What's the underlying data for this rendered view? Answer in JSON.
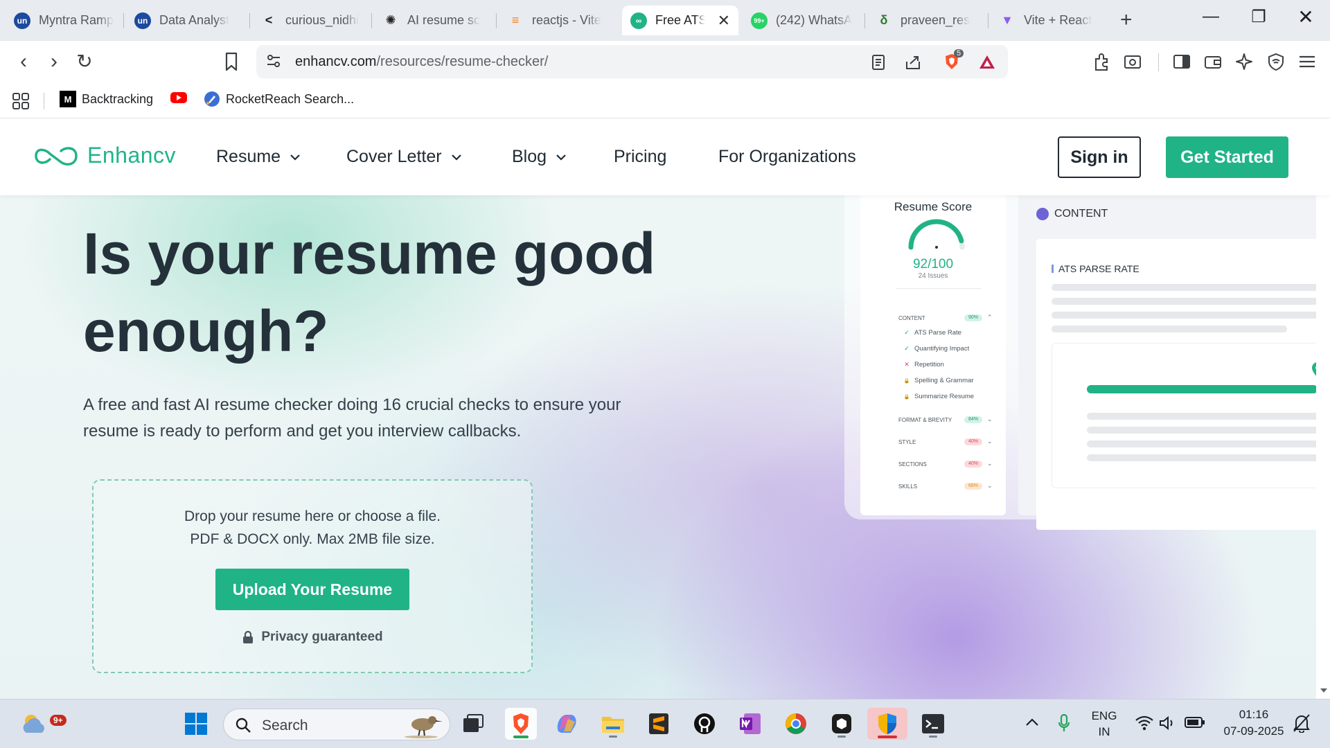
{
  "browser": {
    "tabs": [
      {
        "title": "Myntra Ramp",
        "icon": "unstop-icon",
        "color": "#1c4a9e"
      },
      {
        "title": "Data Analyst",
        "icon": "unstop-icon",
        "color": "#1c4a9e"
      },
      {
        "title": "curious_nidhi",
        "icon": "code-icon",
        "color": "#222"
      },
      {
        "title": "AI resume sc",
        "icon": "openai-icon",
        "color": "#222"
      },
      {
        "title": "reactjs - Vite",
        "icon": "stackoverflow-icon",
        "color": "#f48024"
      },
      {
        "title": "Free ATS",
        "icon": "enhancv-icon",
        "color": "#20b386",
        "active": true
      },
      {
        "title": "(242) WhatsA",
        "icon": "whatsapp-icon",
        "color": "#25d366",
        "badge": "99+"
      },
      {
        "title": "praveen_res",
        "icon": "leaf-icon",
        "color": "#2f7d32"
      },
      {
        "title": "Vite + React",
        "icon": "vite-icon",
        "color": "#8b5cf6"
      }
    ],
    "url_domain": "enhancv.com",
    "url_path": "/resources/resume-checker/",
    "brave_shield_count": "5",
    "bookmarks": [
      {
        "label": "Backtracking",
        "icon": "medium-icon"
      },
      {
        "label": "",
        "icon": "youtube-icon"
      },
      {
        "label": "RocketReach Search...",
        "icon": "rocketreach-icon"
      }
    ]
  },
  "site": {
    "logo_text": "Enhancv",
    "nav": [
      {
        "label": "Resume",
        "dropdown": true
      },
      {
        "label": "Cover Letter",
        "dropdown": true
      },
      {
        "label": "Blog",
        "dropdown": true
      },
      {
        "label": "Pricing",
        "dropdown": false
      },
      {
        "label": "For Organizations",
        "dropdown": false
      }
    ],
    "signin_label": "Sign in",
    "get_started_label": "Get Started",
    "brand_color": "#20b386"
  },
  "hero": {
    "title": "Is your resume good enough?",
    "subtitle": "A free and fast AI resume checker doing 16 crucial checks to ensure your resume is ready to perform and get you interview callbacks.",
    "drop_line1": "Drop your resume here or choose a file.",
    "drop_line2": "PDF & DOCX only. Max 2MB file size.",
    "upload_label": "Upload Your Resume",
    "privacy_label": "Privacy guaranteed"
  },
  "mock": {
    "score_title": "Resume Score",
    "score_value": "92/100",
    "score_fraction": 0.92,
    "issues": "24 Issues",
    "categories": [
      {
        "name": "CONTENT",
        "pct": "90%",
        "tone": "green",
        "expanded": true
      },
      {
        "name": "FORMAT & BREVITY",
        "pct": "84%",
        "tone": "green",
        "expanded": false
      },
      {
        "name": "STYLE",
        "pct": "40%",
        "tone": "red",
        "expanded": false
      },
      {
        "name": "SECTIONS",
        "pct": "40%",
        "tone": "red",
        "expanded": false
      },
      {
        "name": "SKILLS",
        "pct": "68%",
        "tone": "orange",
        "expanded": false
      }
    ],
    "content_items": [
      {
        "label": "ATS Parse Rate",
        "mark": "check"
      },
      {
        "label": "Quantifying Impact",
        "mark": "check"
      },
      {
        "label": "Repetition",
        "mark": "cross"
      },
      {
        "label": "Spelling & Grammar",
        "mark": "lock"
      },
      {
        "label": "Summarize Resume",
        "mark": "lock"
      }
    ],
    "content_heading": "CONTENT",
    "ats_label": "ATS PARSE RATE",
    "ats_progress": 0.9
  },
  "taskbar": {
    "weather_badge": "9+",
    "search_placeholder": "Search",
    "lang_line1": "ENG",
    "lang_line2": "IN",
    "time": "01:16",
    "date": "07-09-2025",
    "apps": [
      "windows-start-icon",
      "search",
      "task-view-icon",
      "brave-icon",
      "copilot-icon",
      "file-explorer-icon",
      "sublime-icon",
      "github-icon",
      "onenote-icon",
      "chrome-icon",
      "app-icon",
      "security-icon",
      "terminal-icon"
    ]
  }
}
